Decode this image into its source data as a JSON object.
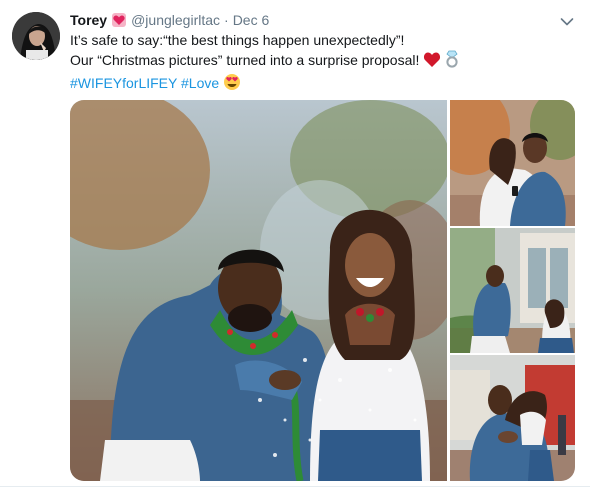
{
  "tweet": {
    "author": {
      "display_name": "Torey",
      "handle": "@junglegirltac",
      "badge_icon": "heart-emoji",
      "badge_color": "#e0245e"
    },
    "separator": "·",
    "date": "Dec 6",
    "text": {
      "line1": "It’s safe to say:“the best things happen unexpectedly”!",
      "line2": "Our “Christmas pictures” turned into a surprise proposal!",
      "line2_emojis": [
        "red-heart-emoji",
        "ring-emoji"
      ],
      "hashtags": [
        "#WIFEYforLIFEY",
        "#Love"
      ],
      "hashtag_emoji": "heart-eyes-emoji"
    },
    "menu_icon": "chevron-down-icon",
    "media": {
      "photo_count": 4,
      "photos": [
        "main-couple-blowing-snow",
        "couple-embrace",
        "kneeling-proposal",
        "hug-after-proposal"
      ]
    }
  },
  "colors": {
    "text": "#14171a",
    "muted": "#657786",
    "link": "#1b95e0",
    "heart": "#e0245e"
  }
}
